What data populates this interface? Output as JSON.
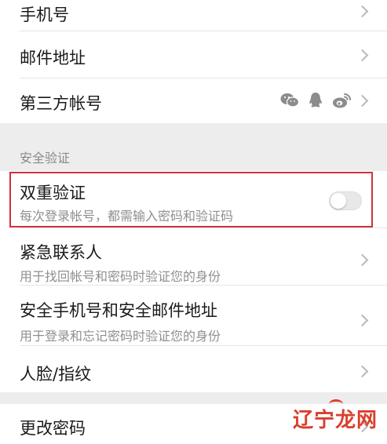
{
  "account_group": {
    "items": [
      {
        "label": "手机号"
      },
      {
        "label": "邮件地址"
      },
      {
        "label": "第三方帐号",
        "icons": [
          "wechat-icon",
          "qq-icon",
          "weibo-icon"
        ]
      }
    ]
  },
  "security_section": {
    "label": "安全验证",
    "two_factor": {
      "label": "双重验证",
      "description": "每次登录帐号，都需输入密码和验证码",
      "enabled": false
    },
    "emergency_contact": {
      "label": "紧急联系人",
      "description": "用于找回帐号和密码时验证您的身份"
    },
    "secure_phone_email": {
      "label": "安全手机号和安全邮件地址",
      "description": "用于登录和忘记密码时验证您的身份"
    },
    "face_fingerprint": {
      "label": "人脸/指纹"
    }
  },
  "password_group": {
    "change_password": {
      "label": "更改密码"
    }
  },
  "watermark": {
    "text": "辽宁龙网"
  },
  "colors": {
    "highlight_border": "#d2303a",
    "watermark": "#d9402f",
    "background": "#ededed"
  }
}
